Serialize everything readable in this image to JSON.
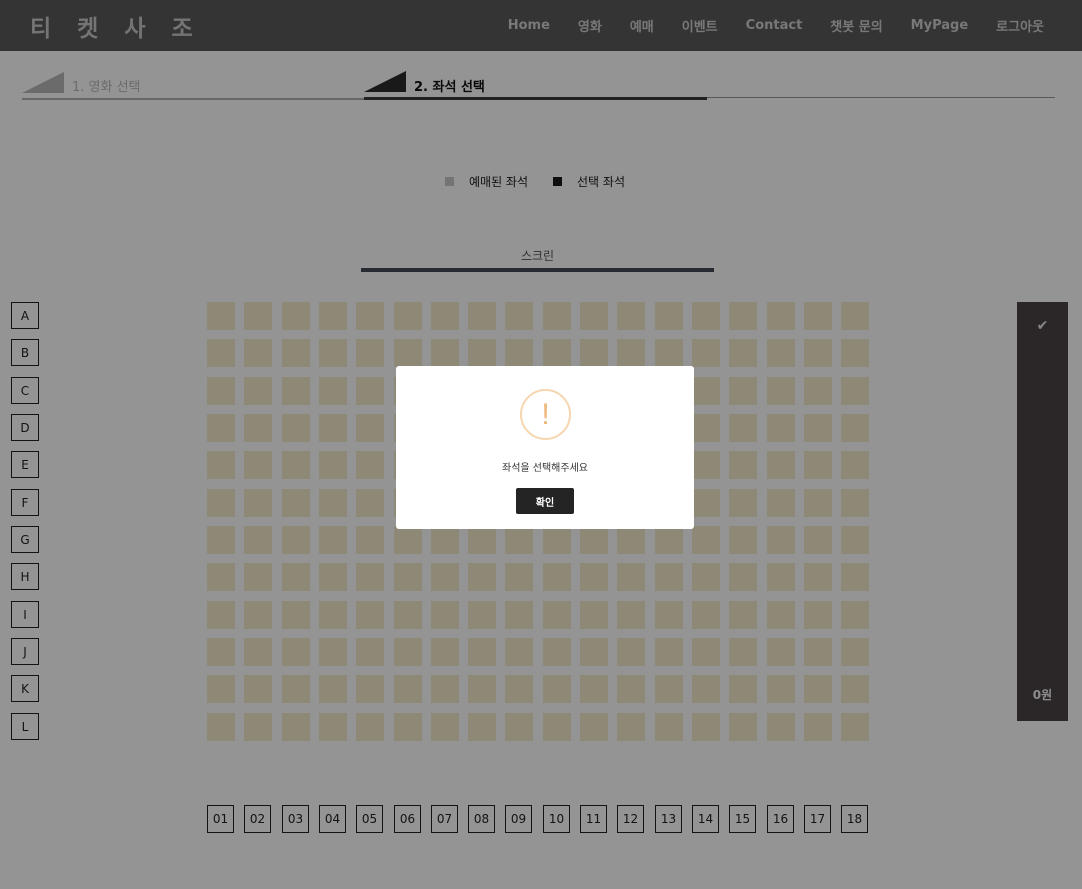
{
  "header": {
    "brand": "티 켓 사 조",
    "nav": [
      "Home",
      "영화",
      "예매",
      "이벤트",
      "Contact",
      "챗봇 문의",
      "MyPage",
      "로그아웃"
    ]
  },
  "steps": [
    {
      "label": "1. 영화 선택",
      "active": false
    },
    {
      "label": "2. 좌석 선택",
      "active": true
    }
  ],
  "legend": {
    "booked": "예매된 좌석",
    "selected": "선택 좌석"
  },
  "screen": {
    "label": "스크린"
  },
  "rows": [
    "A",
    "B",
    "C",
    "D",
    "E",
    "F",
    "G",
    "H",
    "I",
    "J",
    "K",
    "L"
  ],
  "columns": [
    "01",
    "02",
    "03",
    "04",
    "05",
    "06",
    "07",
    "08",
    "09",
    "10",
    "11",
    "12",
    "13",
    "14",
    "15",
    "16",
    "17",
    "18"
  ],
  "side_panel": {
    "check_icon": "check-icon",
    "price": "0원"
  },
  "modal": {
    "icon": "exclamation-icon",
    "message": "좌석을 선택해주세요",
    "confirm": "확인"
  },
  "colors": {
    "header": "#5a5a5a",
    "seat": "#f4ebcd",
    "screen_bar": "#424a55",
    "panel": "#4b4446",
    "alert": "#f0b77a"
  }
}
